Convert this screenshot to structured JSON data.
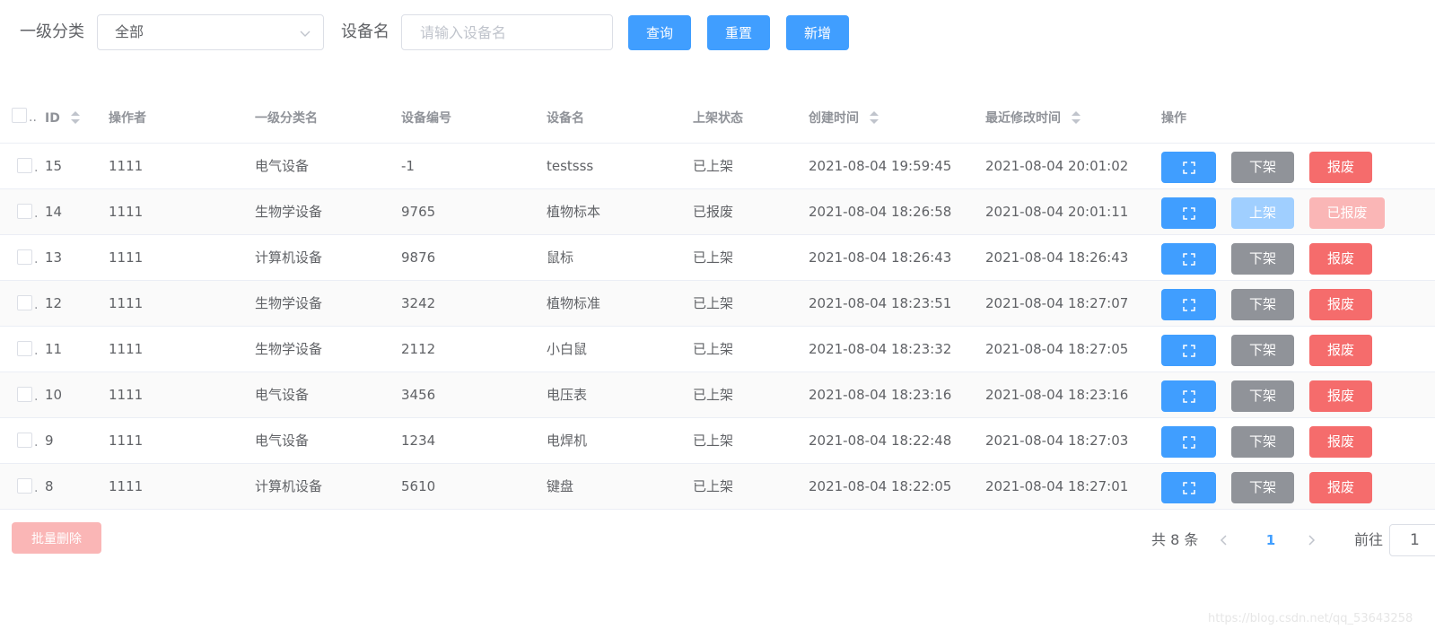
{
  "filters": {
    "category_label": "一级分类",
    "category_value": "全部",
    "device_name_label": "设备名",
    "device_name_placeholder": "请输入设备名",
    "search_button": "查询",
    "reset_button": "重置",
    "add_button": "新增"
  },
  "table": {
    "select_all_ellipsis": "..",
    "columns": {
      "id": "ID",
      "operator": "操作者",
      "category": "一级分类名",
      "device_code": "设备编号",
      "device_name": "设备名",
      "shelf_status": "上架状态",
      "created_time": "创建时间",
      "modified_time": "最近修改时间",
      "actions": "操作"
    },
    "rows": [
      {
        "id": "15",
        "operator": "1111",
        "category": "电气设备",
        "device_code": "-1",
        "device_name": "testsss",
        "status": "已上架",
        "created": "2021-08-04 19:59:45",
        "modified": "2021-08-04 20:01:02",
        "shelf_action": "下架",
        "scrap_action": "报废",
        "shelf_enabled": true,
        "scrap_enabled": true
      },
      {
        "id": "14",
        "operator": "1111",
        "category": "生物学设备",
        "device_code": "9765",
        "device_name": "植物标本",
        "status": "已报废",
        "created": "2021-08-04 18:26:58",
        "modified": "2021-08-04 20:01:11",
        "shelf_action": "上架",
        "scrap_action": "已报废",
        "shelf_enabled": false,
        "scrap_enabled": false
      },
      {
        "id": "13",
        "operator": "1111",
        "category": "计算机设备",
        "device_code": "9876",
        "device_name": "鼠标",
        "status": "已上架",
        "created": "2021-08-04 18:26:43",
        "modified": "2021-08-04 18:26:43",
        "shelf_action": "下架",
        "scrap_action": "报废",
        "shelf_enabled": true,
        "scrap_enabled": true
      },
      {
        "id": "12",
        "operator": "1111",
        "category": "生物学设备",
        "device_code": "3242",
        "device_name": "植物标准",
        "status": "已上架",
        "created": "2021-08-04 18:23:51",
        "modified": "2021-08-04 18:27:07",
        "shelf_action": "下架",
        "scrap_action": "报废",
        "shelf_enabled": true,
        "scrap_enabled": true
      },
      {
        "id": "11",
        "operator": "1111",
        "category": "生物学设备",
        "device_code": "2112",
        "device_name": "小白鼠",
        "status": "已上架",
        "created": "2021-08-04 18:23:32",
        "modified": "2021-08-04 18:27:05",
        "shelf_action": "下架",
        "scrap_action": "报废",
        "shelf_enabled": true,
        "scrap_enabled": true
      },
      {
        "id": "10",
        "operator": "1111",
        "category": "电气设备",
        "device_code": "3456",
        "device_name": "电压表",
        "status": "已上架",
        "created": "2021-08-04 18:23:16",
        "modified": "2021-08-04 18:23:16",
        "shelf_action": "下架",
        "scrap_action": "报废",
        "shelf_enabled": true,
        "scrap_enabled": true
      },
      {
        "id": "9",
        "operator": "1111",
        "category": "电气设备",
        "device_code": "1234",
        "device_name": "电焊机",
        "status": "已上架",
        "created": "2021-08-04 18:22:48",
        "modified": "2021-08-04 18:27:03",
        "shelf_action": "下架",
        "scrap_action": "报废",
        "shelf_enabled": true,
        "scrap_enabled": true
      },
      {
        "id": "8",
        "operator": "1111",
        "category": "计算机设备",
        "device_code": "5610",
        "device_name": "键盘",
        "status": "已上架",
        "created": "2021-08-04 18:22:05",
        "modified": "2021-08-04 18:27:01",
        "shelf_action": "下架",
        "scrap_action": "报废",
        "shelf_enabled": true,
        "scrap_enabled": true
      }
    ]
  },
  "footer": {
    "batch_delete": "批量删除",
    "total_text": "共 8 条",
    "current_page": "1",
    "jump_label": "前往",
    "jump_value": "1"
  },
  "watermark": "https://blog.csdn.net/qq_53643258",
  "icons": {
    "view_action": "expand-icon",
    "category_dropdown": "chevron-down-icon",
    "pager_prev": "chevron-left-icon",
    "pager_next": "chevron-right-icon",
    "sort": "sort-caret-icon"
  },
  "colors": {
    "primary": "#409eff",
    "primary_disabled": "#a0cfff",
    "info": "#909399",
    "danger": "#f56c6c",
    "danger_disabled": "#fab6b6",
    "border": "#dcdfe6",
    "header_text": "#909399",
    "body_text": "#606266",
    "stripe": "#fafafa"
  }
}
